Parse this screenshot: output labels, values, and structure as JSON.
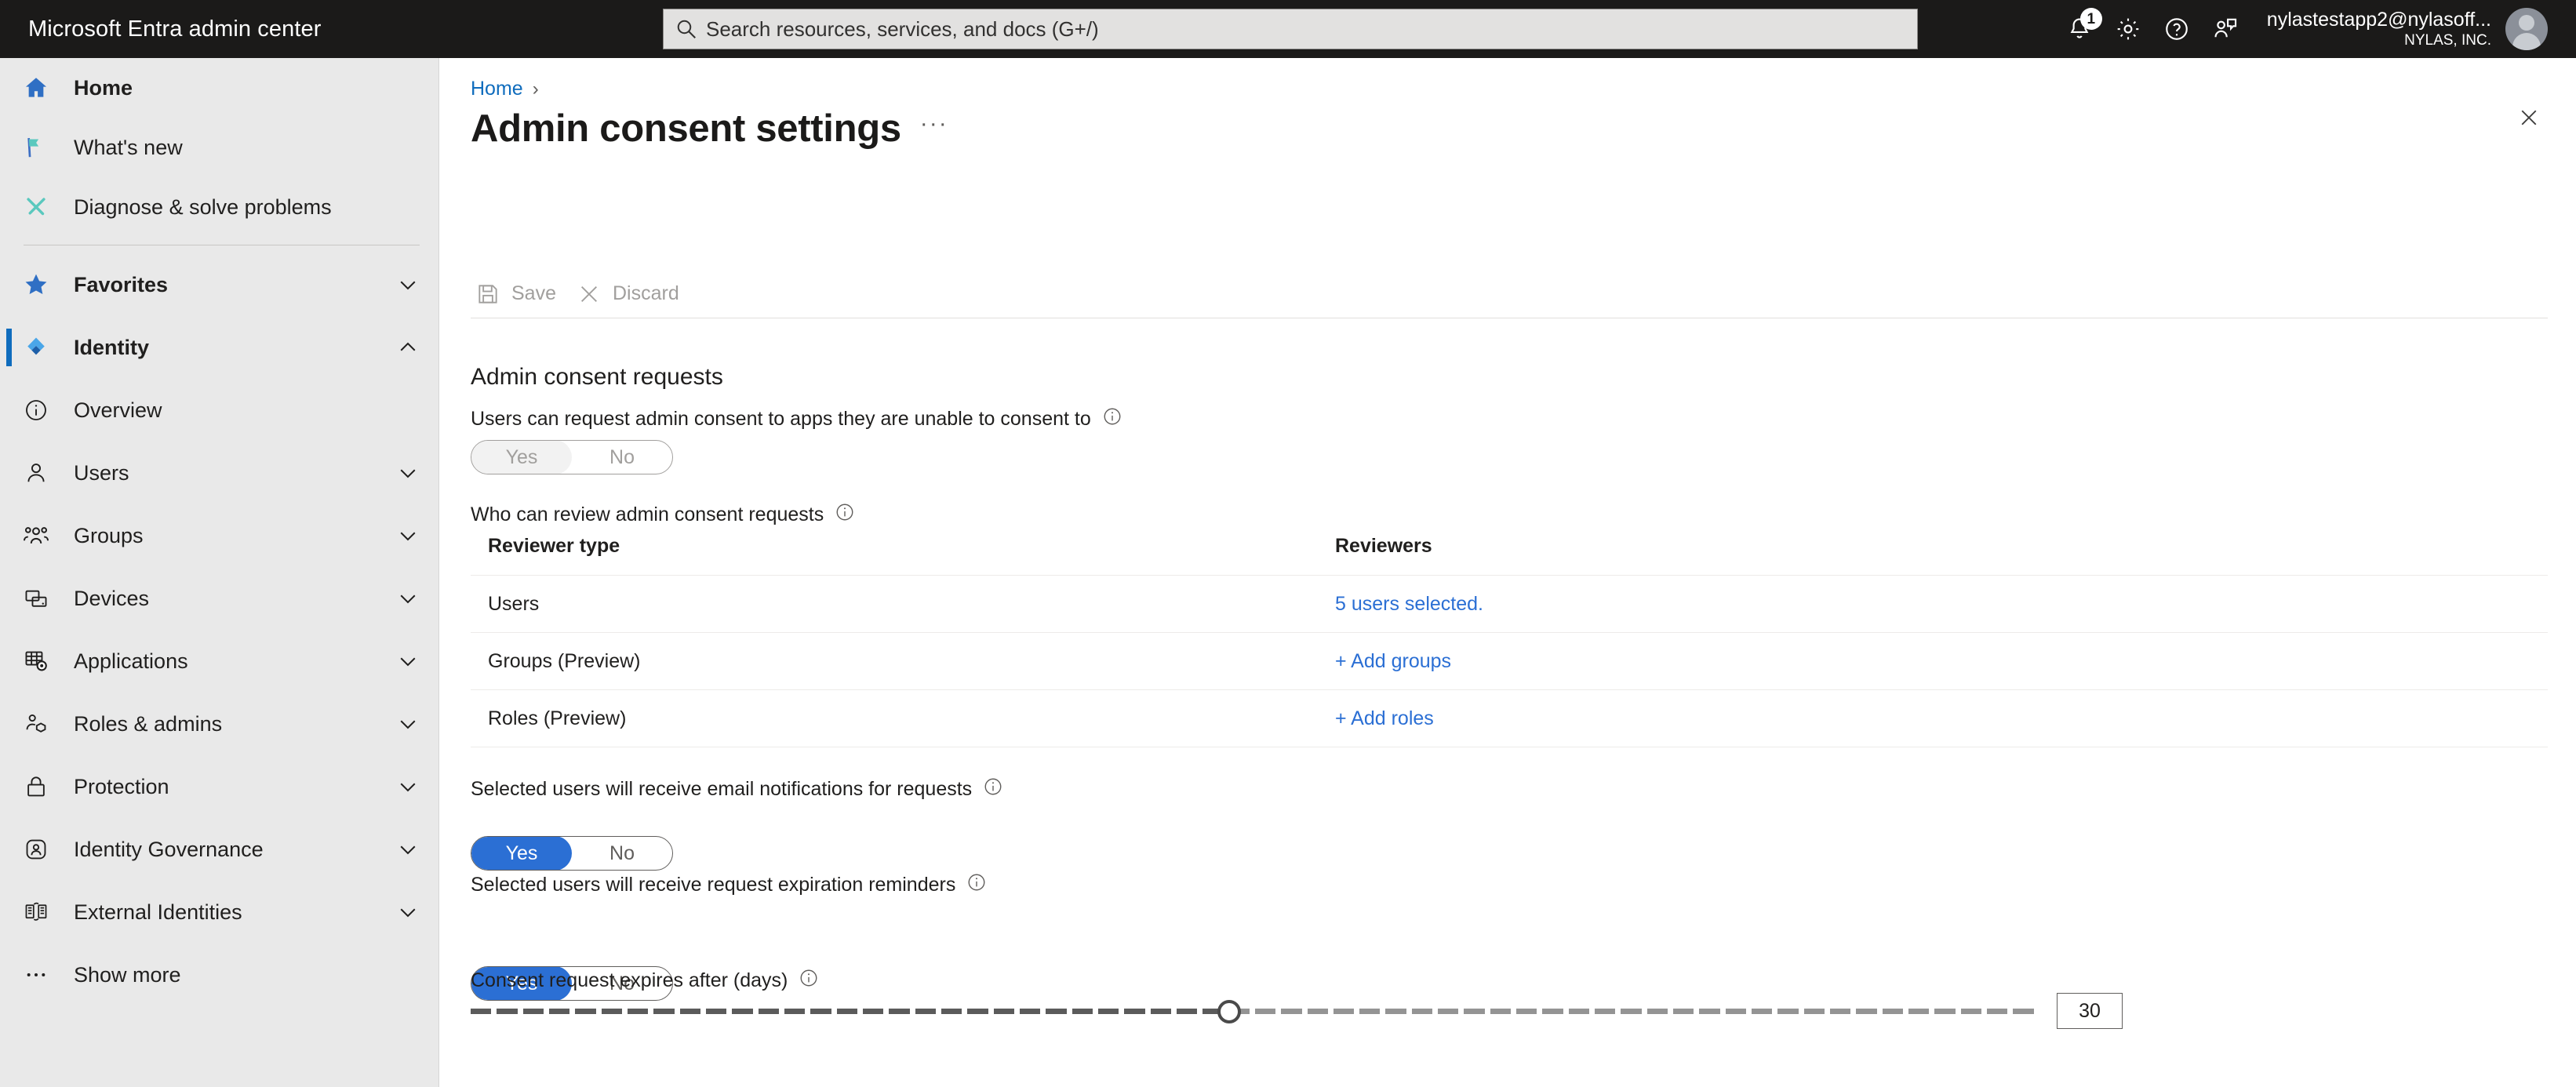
{
  "topbar": {
    "brand": "Microsoft Entra admin center",
    "search": {
      "placeholder": "Search resources, services, and docs (G+/)",
      "icon": "search-icon"
    },
    "notifications": {
      "icon": "bell-icon",
      "count": "1"
    },
    "settings": {
      "icon": "gear-icon"
    },
    "help": {
      "icon": "question-circle-icon"
    },
    "feedback": {
      "icon": "feedback-person-icon"
    },
    "account": {
      "name": "nylastestapp2@nylasoff...",
      "org": "NYLAS, INC.",
      "avatar": "avatar-icon"
    }
  },
  "sidebar": {
    "items": [
      {
        "label": "Home",
        "icon": "home-icon",
        "chevron": "",
        "bold": true,
        "active": false
      },
      {
        "label": "What's new",
        "icon": "flag-icon",
        "chevron": "",
        "bold": false,
        "active": false
      },
      {
        "label": "Diagnose & solve problems",
        "icon": "tools-icon",
        "chevron": "",
        "bold": false,
        "active": false
      },
      {
        "label": "Favorites",
        "icon": "star-icon",
        "chevron": "chevron-down-icon",
        "bold": true,
        "active": false
      },
      {
        "label": "Identity",
        "icon": "entra-identity-icon",
        "chevron": "chevron-up-icon",
        "bold": true,
        "active": true
      },
      {
        "label": "Overview",
        "icon": "info-circle-icon",
        "chevron": "",
        "bold": false,
        "active": false
      },
      {
        "label": "Users",
        "icon": "user-icon",
        "chevron": "chevron-down-icon",
        "bold": false,
        "active": false
      },
      {
        "label": "Groups",
        "icon": "groups-icon",
        "chevron": "chevron-down-icon",
        "bold": false,
        "active": false
      },
      {
        "label": "Devices",
        "icon": "devices-icon",
        "chevron": "chevron-down-icon",
        "bold": false,
        "active": false
      },
      {
        "label": "Applications",
        "icon": "applications-grid-icon",
        "chevron": "chevron-down-icon",
        "bold": false,
        "active": false
      },
      {
        "label": "Roles & admins",
        "icon": "roles-admins-icon",
        "chevron": "chevron-down-icon",
        "bold": false,
        "active": false
      },
      {
        "label": "Protection",
        "icon": "lock-icon",
        "chevron": "chevron-down-icon",
        "bold": false,
        "active": false
      },
      {
        "label": "Identity Governance",
        "icon": "governance-icon",
        "chevron": "chevron-down-icon",
        "bold": false,
        "active": false
      },
      {
        "label": "External Identities",
        "icon": "external-identities-icon",
        "chevron": "chevron-down-icon",
        "bold": false,
        "active": false
      },
      {
        "label": "Show more",
        "icon": "ellipsis-icon",
        "chevron": "",
        "bold": false,
        "active": false
      }
    ]
  },
  "main": {
    "breadcrumb": {
      "home": "Home",
      "separator": "›"
    },
    "title": "Admin consent settings",
    "more_actions": "···",
    "close": "close-icon",
    "commandbar": {
      "save": {
        "label": "Save",
        "icon": "save-floppy-icon"
      },
      "discard": {
        "label": "Discard",
        "icon": "discard-x-icon"
      }
    },
    "section_title": "Admin consent requests",
    "fields": {
      "users_can_request": {
        "label": "Users can request admin consent to apps they are unable to consent to",
        "info": "info-icon",
        "yes": "Yes",
        "no": "No",
        "selected": "Yes",
        "disabled": true
      },
      "who_can_review": {
        "label": "Who can review admin consent requests",
        "info": "info-icon"
      },
      "email_notifications": {
        "label": "Selected users will receive email notifications for requests",
        "info": "info-icon",
        "yes": "Yes",
        "no": "No",
        "selected": "Yes",
        "disabled": false
      },
      "expiration_reminders": {
        "label": "Selected users will receive request expiration reminders",
        "info": "info-icon",
        "yes": "Yes",
        "no": "No",
        "selected": "Yes",
        "disabled": false
      },
      "expires_after": {
        "label": "Consent request expires after (days)",
        "info": "info-icon",
        "value": "30",
        "min": 1,
        "max": 60,
        "segments": 60,
        "filled_segments": 29
      }
    },
    "table": {
      "columns": [
        "Reviewer type",
        "Reviewers"
      ],
      "rows": [
        {
          "type": "Users",
          "reviewers": "5 users selected."
        },
        {
          "type": "Groups (Preview)",
          "reviewers": "+ Add groups"
        },
        {
          "type": "Roles (Preview)",
          "reviewers": "+ Add roles"
        }
      ]
    }
  },
  "colors": {
    "topbar_bg": "#1b1a19",
    "sidebar_bg": "#e9e9e9",
    "accent_blue": "#2b6fd4",
    "link_blue": "#0f6cbd",
    "toggle_on": "#2b6fd4",
    "slider_fill": "#5b5b5b",
    "slider_rest": "#949494"
  }
}
